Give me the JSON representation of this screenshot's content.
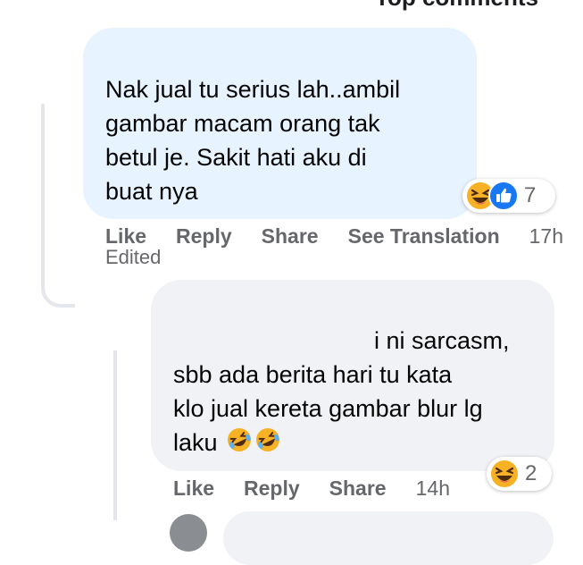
{
  "header": {
    "title_partial": "Top comments"
  },
  "comments": [
    {
      "text_lines": [
        "Nak jual tu serius lah..ambil",
        "gambar macam orang tak",
        "betul je. Sakit hati aku di",
        "buat nya"
      ],
      "reactions": {
        "icons": [
          "laugh-react-icon",
          "like-react-icon"
        ],
        "count": "7"
      },
      "actions": {
        "like": "Like",
        "reply": "Reply",
        "share": "Share",
        "translate": "See Translation",
        "time": "17h"
      },
      "edited": "Edited"
    },
    {
      "text_lines": [
        "i ni sarcasm,",
        "sbb ada berita hari tu kata",
        "klo jual kereta gambar blur lg",
        "laku"
      ],
      "reactions": {
        "icons": [
          "laugh-react-icon"
        ],
        "count": "2"
      },
      "actions": {
        "like": "Like",
        "reply": "Reply",
        "share": "Share",
        "time": "14h"
      }
    }
  ],
  "colors": {
    "bubble_highlight": "#e7f3ff",
    "bubble_default": "#f0f2f5",
    "meta_text": "#65676b",
    "like_blue": "#1877f2",
    "haha_yellow": "#f7b125"
  }
}
